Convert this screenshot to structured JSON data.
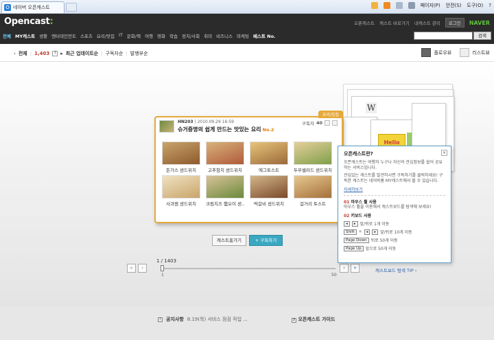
{
  "browser": {
    "tab_title": "네이버 오픈캐스트",
    "cmd_page": "페이지(P)",
    "cmd_safety": "안전(S)",
    "cmd_tools": "도구(O)",
    "cmd_help": "?"
  },
  "header": {
    "logo": "Opencast",
    "util_links": [
      "오픈캐스트",
      "캐스트 바로가기",
      "내캐스트 관리"
    ],
    "login_label": "로그인",
    "naver_label": "NAVER",
    "categories": [
      "전체",
      "MY캐스트",
      "생활",
      "엔터테인먼트",
      "스포츠",
      "요리/맛집",
      "IT",
      "문화/책",
      "여행",
      "영화",
      "학습",
      "정치/사회",
      "취미",
      "비즈니스",
      "마케팅",
      "베스트 No."
    ],
    "search_button": "검색"
  },
  "sortbar": {
    "all_label": "전체",
    "count": "1,403",
    "current_sort": "최근 업데이트순",
    "sort_options": [
      "구독자순",
      "발행부순"
    ],
    "view_card": "플로우뷰",
    "view_list": "리스트뷰"
  },
  "card": {
    "category_tag": "요리/맛집",
    "author": "HN203",
    "date": "2010.09.29 16:59",
    "subscribers_label": "구독자",
    "subscribers_count": "40",
    "title": "슈거증명의 쉽게 만드는 맛있는 요리",
    "badge": "No.2",
    "items": [
      {
        "caption": "돈가스 샌드위치",
        "c1": "#c9a46a",
        "c2": "#8e5a2e"
      },
      {
        "caption": "고추참치 샌드위치",
        "c1": "#d7b37a",
        "c2": "#b05a3a"
      },
      {
        "caption": "에그토스트",
        "c1": "#e8c47a",
        "c2": "#9a6a3a"
      },
      {
        "caption": "두부샐러드 샌드위치",
        "c1": "#e5cf9a",
        "c2": "#7fa04a"
      },
      {
        "caption": "사과잼 샌드위치",
        "c1": "#efe2c2",
        "c2": "#c9a46a"
      },
      {
        "caption": "크림치즈 햄오이 샌..",
        "c1": "#d9c29a",
        "c2": "#6a8a3a"
      },
      {
        "caption": "떡갈비 샌드위치",
        "c1": "#d4b68a",
        "c2": "#7a4a2a"
      },
      {
        "caption": "걸거리 토스트",
        "c1": "#e6c890",
        "c2": "#a5703a"
      }
    ]
  },
  "buttons": {
    "home": "캐스트홈가기",
    "subscribe": "+ 구독하기"
  },
  "pager": {
    "position": "1 / 1403",
    "min_label": "1",
    "max_label": "50",
    "prev_all": "«",
    "prev": "‹",
    "next": "›",
    "next_all": "»",
    "tip_link": "캐스트보드 탐색 TIP ›"
  },
  "popup": {
    "title": "오픈캐스트란?",
    "desc1": "오픈캐스트는 여행자 누구나 자신의 관심정보를 쉽어 공유하는 서비스입니다.",
    "desc2": "관심있는 캐스트를 발견하시면 구독하기를 클릭하세요! 구독한 캐스트는 네이버홈 MY캐스트에서 볼 수 있습니다.",
    "more": "자세히보기",
    "sec1_num": "01",
    "sec1_title": "마우스 휠 사용",
    "sec1_desc": "마우스 휠을 이용해서 캐스트보드를 탐색해 보세요!",
    "sec2_num": "02",
    "sec2_title": "키보드 사용",
    "key1": "앞/뒤로 1개 이동",
    "key2": "앞/뒤로 10개 이동",
    "key3": "뒤로 50개 이동",
    "key4": "앞으로 50개 이동",
    "shift_label": "Shift",
    "pagedown_label": "Page Down",
    "pageup_label": "Page Up"
  },
  "footer": {
    "notice_label": "공지사항",
    "notice_text": "8.19(목) 서비스 점검 작업 ...",
    "guide": "오픈캐스트 가이드"
  }
}
